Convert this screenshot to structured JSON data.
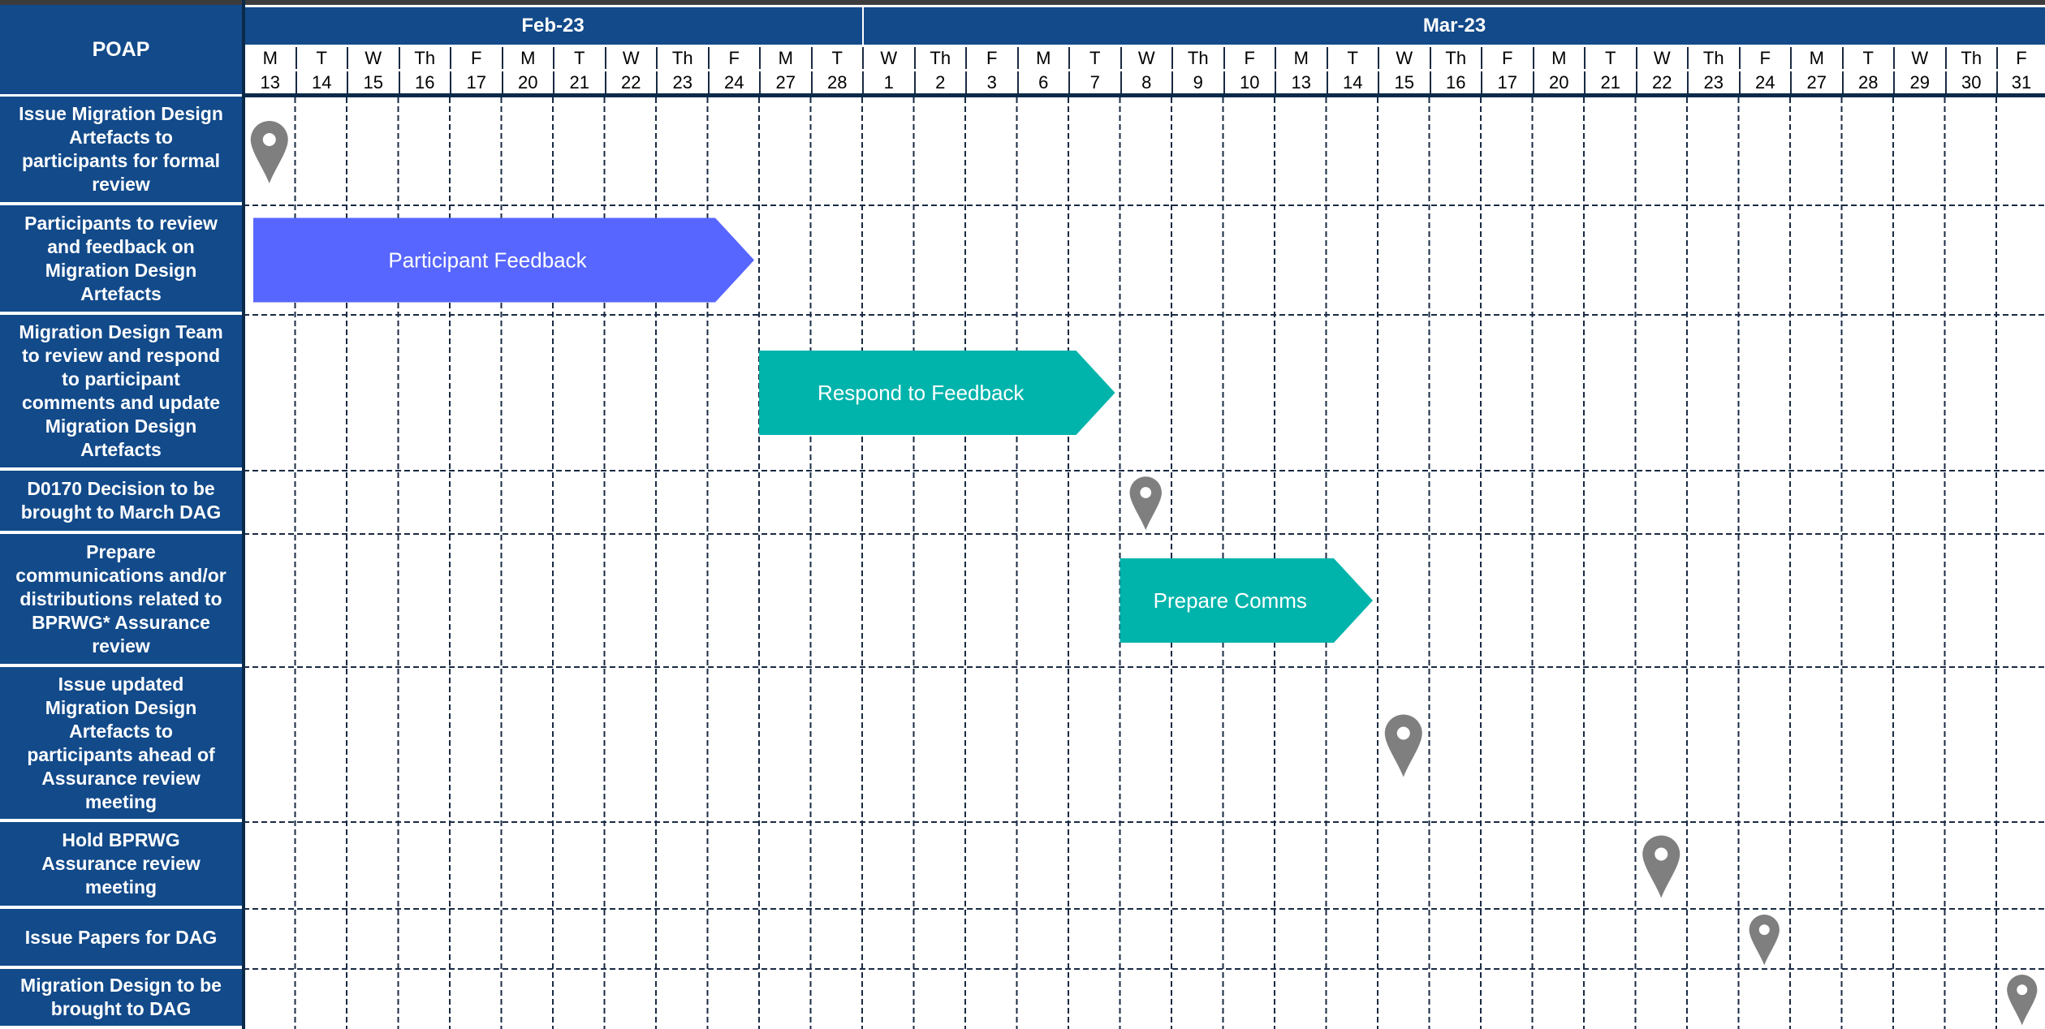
{
  "header": {
    "corner": "POAP"
  },
  "months": [
    {
      "label": "Feb-23",
      "first_day_index": 0,
      "last_day_index": 11
    },
    {
      "label": "Mar-23",
      "first_day_index": 12,
      "last_day_index": 34
    }
  ],
  "days": [
    {
      "dow": "M",
      "date": "13"
    },
    {
      "dow": "T",
      "date": "14"
    },
    {
      "dow": "W",
      "date": "15"
    },
    {
      "dow": "Th",
      "date": "16"
    },
    {
      "dow": "F",
      "date": "17"
    },
    {
      "dow": "M",
      "date": "20"
    },
    {
      "dow": "T",
      "date": "21"
    },
    {
      "dow": "W",
      "date": "22"
    },
    {
      "dow": "Th",
      "date": "23"
    },
    {
      "dow": "F",
      "date": "24"
    },
    {
      "dow": "M",
      "date": "27"
    },
    {
      "dow": "T",
      "date": "28"
    },
    {
      "dow": "W",
      "date": "1"
    },
    {
      "dow": "Th",
      "date": "2"
    },
    {
      "dow": "F",
      "date": "3"
    },
    {
      "dow": "M",
      "date": "6"
    },
    {
      "dow": "T",
      "date": "7"
    },
    {
      "dow": "W",
      "date": "8"
    },
    {
      "dow": "Th",
      "date": "9"
    },
    {
      "dow": "F",
      "date": "10"
    },
    {
      "dow": "M",
      "date": "13"
    },
    {
      "dow": "T",
      "date": "14"
    },
    {
      "dow": "W",
      "date": "15"
    },
    {
      "dow": "Th",
      "date": "16"
    },
    {
      "dow": "F",
      "date": "17"
    },
    {
      "dow": "M",
      "date": "20"
    },
    {
      "dow": "T",
      "date": "21"
    },
    {
      "dow": "W",
      "date": "22"
    },
    {
      "dow": "Th",
      "date": "23"
    },
    {
      "dow": "F",
      "date": "24"
    },
    {
      "dow": "M",
      "date": "27"
    },
    {
      "dow": "T",
      "date": "28"
    },
    {
      "dow": "W",
      "date": "29"
    },
    {
      "dow": "Th",
      "date": "30"
    },
    {
      "dow": "F",
      "date": "31"
    }
  ],
  "rows": [
    {
      "label": "Issue Migration Design Artefacts to participants for formal review",
      "milestone_day_index": 0
    },
    {
      "label": "Participants to review and feedback on Migration Design Artefacts",
      "bar": {
        "label": "Participant Feedback",
        "start_day_index": 0,
        "end_day_index": 9,
        "color": "#5766fe"
      }
    },
    {
      "label": "Migration Design Team to review and respond to participant comments and update Migration Design Artefacts",
      "bar": {
        "label": "Respond to Feedback",
        "start_day_index": 10,
        "end_day_index": 16,
        "color": "#00b4ab"
      }
    },
    {
      "label": "D0170 Decision to be brought to March DAG",
      "milestone_day_index": 17
    },
    {
      "label": "Prepare communications and/or distributions related to BPRWG* Assurance review",
      "bar": {
        "label": "Prepare Comms",
        "start_day_index": 17,
        "end_day_index": 21,
        "color": "#00b4ab"
      }
    },
    {
      "label": "Issue updated Migration Design Artefacts to participants ahead of Assurance review meeting",
      "milestone_day_index": 22
    },
    {
      "label": "Hold BPRWG Assurance review meeting",
      "milestone_day_index": 27
    },
    {
      "label": "Issue Papers for DAG",
      "milestone_day_index": 29
    },
    {
      "label": "Migration Design to be brought to DAG",
      "milestone_day_index": 34
    }
  ],
  "colors": {
    "header_bg": "#124a8a",
    "milestone": "#7f7f7f",
    "grid_line": "#1a2a44"
  },
  "icons": {
    "milestone": "map-pin-icon"
  }
}
